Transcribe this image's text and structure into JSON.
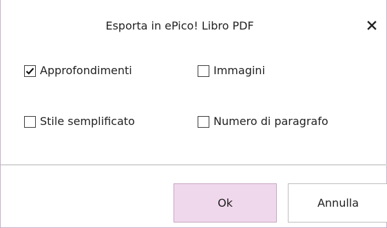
{
  "dialog": {
    "title": "Esporta in ePico! Libro PDF",
    "close_icon": "close-icon"
  },
  "options": [
    {
      "label": "Approfondimenti",
      "checked": true
    },
    {
      "label": "Immagini",
      "checked": false
    },
    {
      "label": "Stile semplificato",
      "checked": false
    },
    {
      "label": "Numero di paragrafo",
      "checked": false
    }
  ],
  "buttons": {
    "ok_label": "Ok",
    "cancel_label": "Annulla"
  },
  "colors": {
    "ok_button_bg": "#f0d8ec",
    "window_border": "#c8b0c8"
  }
}
